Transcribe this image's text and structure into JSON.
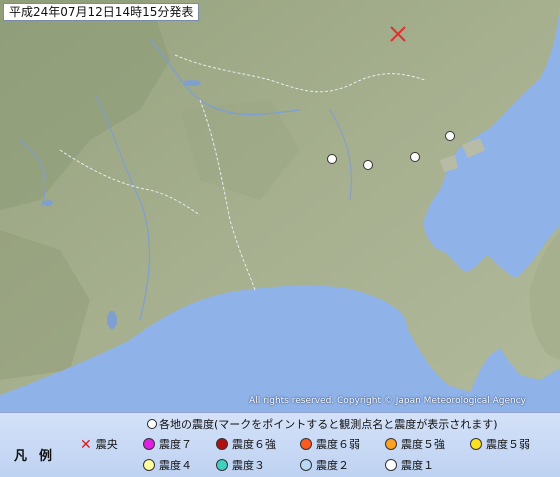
{
  "report_time": "平成24年07月12日14時15分発表",
  "copyright": "All rights reserved. Copyright © Japan Meteorological Agency",
  "legend": {
    "caption": "各地の震度(マークをポイントすると観測点名と震度が表示されます)",
    "title": "凡例",
    "epicenter_label": "震央",
    "items": [
      {
        "label": "震度７",
        "color": "#e020e0"
      },
      {
        "label": "震度６強",
        "color": "#b01010"
      },
      {
        "label": "震度６弱",
        "color": "#ff5a1e"
      },
      {
        "label": "震度５強",
        "color": "#ffa020"
      },
      {
        "label": "震度５弱",
        "color": "#ffe020"
      },
      {
        "label": "震度４",
        "color": "#ffffa0"
      },
      {
        "label": "震度３",
        "color": "#40d0c0"
      },
      {
        "label": "震度２",
        "color": "#b8d8f8"
      },
      {
        "label": "震度１",
        "color": "#ffffff"
      }
    ]
  },
  "map": {
    "land_color": "#a2ad8a",
    "land_dark_color": "#8d9a76",
    "sea_color": "#8fb2e8",
    "epicenter_color": "#e03030",
    "intensity_1_markers": 4
  }
}
